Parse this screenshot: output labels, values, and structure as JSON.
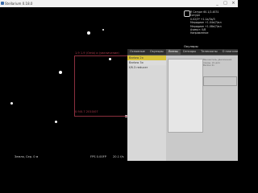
{
  "window": {
    "title": "Stellarium 0.18.0",
    "buttons": [
      "_",
      "□",
      "×"
    ]
  },
  "sky": {
    "fov_labels": {
      "top": "1.9 1.9 (Omb) и (увеличение)",
      "bottom": "0.9/0.7 2010/07"
    },
    "info_lines": [
      "R  Сатурн 60.1/2.4E31",
      "Сатурн",
      "0.02/3* +1.1a/3a/3",
      "Меридиан +1.04e/7/мл",
      "Меридиан +1.08e/7/мл",
      "Азимут: 0/8",
      "Направление"
    ]
  },
  "panel": {
    "header": "Окуляры",
    "tabs": [
      {
        "label": "Основные",
        "active": false
      },
      {
        "label": "Окуляры",
        "active": false
      },
      {
        "label": "Линзы",
        "active": true
      },
      {
        "label": "Сенсоры",
        "active": false
      },
      {
        "label": "Телескопы",
        "active": false
      },
      {
        "label": "О плагине",
        "active": false
      }
    ],
    "rows": [
      {
        "label": "Barlow 2x",
        "selected": true
      },
      {
        "label": "Barlow 3x",
        "selected": false
      },
      {
        "label": "f/6.3 reducer",
        "selected": false
      }
    ],
    "right_text": [
      "Множитель увеличения",
      "линзы. 2x для",
      "Barlow 2x"
    ]
  },
  "status": {
    "location": "Земля, Сер. 0 м",
    "fps": "FPS 0.00FP",
    "extra": "20.1 f/s"
  },
  "colors": {
    "fov_border": "#8a2f3e",
    "selected_row": "#d8c23a"
  }
}
